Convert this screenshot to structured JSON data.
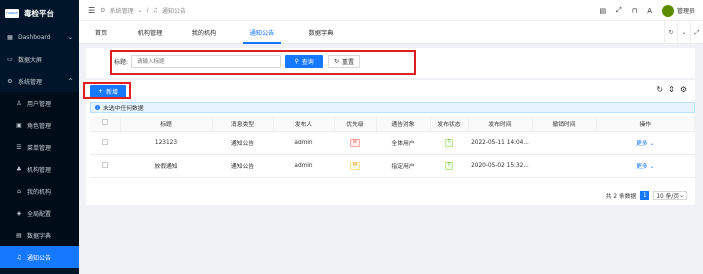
{
  "brand": {
    "logo_text": "FUBRAE",
    "title": "毒检平台"
  },
  "sidebar": {
    "items": [
      {
        "label": "Dashboard",
        "caret": "⌄"
      },
      {
        "label": "数据大屏"
      },
      {
        "label": "系统管理",
        "caret": "^"
      },
      {
        "label": "用户管理"
      },
      {
        "label": "角色管理"
      },
      {
        "label": "菜单管理"
      },
      {
        "label": "机构管理"
      },
      {
        "label": "我的机构"
      },
      {
        "label": "全局配置"
      },
      {
        "label": "数据字典"
      },
      {
        "label": "通知公告"
      }
    ]
  },
  "header": {
    "crumb1": "系统管理",
    "crumb_sep": "/",
    "crumb2": "通知公告",
    "user": "管理员"
  },
  "tabs": [
    "首页",
    "机构管理",
    "我的机构",
    "通知公告",
    "数据字典"
  ],
  "search": {
    "label": "标题:",
    "placeholder": "请输入标题",
    "query": "查询",
    "reset": "重置"
  },
  "list": {
    "add": "新增",
    "alert": "未选中任何数据",
    "columns": [
      "标题",
      "消息类型",
      "发布人",
      "优先级",
      "通告对象",
      "发布状态",
      "发布时间",
      "撤销时间",
      "操作"
    ],
    "rows": [
      {
        "title": "123123",
        "type": "通知公告",
        "publisher": "admin",
        "priority": "H",
        "target": "全体用户",
        "status": "T",
        "time": "2022-05-11 14:04...",
        "revoke": "",
        "op": "更多"
      },
      {
        "title": "放假通知",
        "type": "通知公告",
        "publisher": "admin",
        "priority": "M",
        "target": "指定用户",
        "status": "T",
        "time": "2020-05-02 15:32...",
        "revoke": "",
        "op": "更多"
      }
    ],
    "total": "共 2 条数据",
    "page": "1",
    "page_size": "10 条/页"
  },
  "colors": {
    "accent": "#1677ff",
    "sidebar_bg": "#001529",
    "highlight": "#e02020"
  }
}
